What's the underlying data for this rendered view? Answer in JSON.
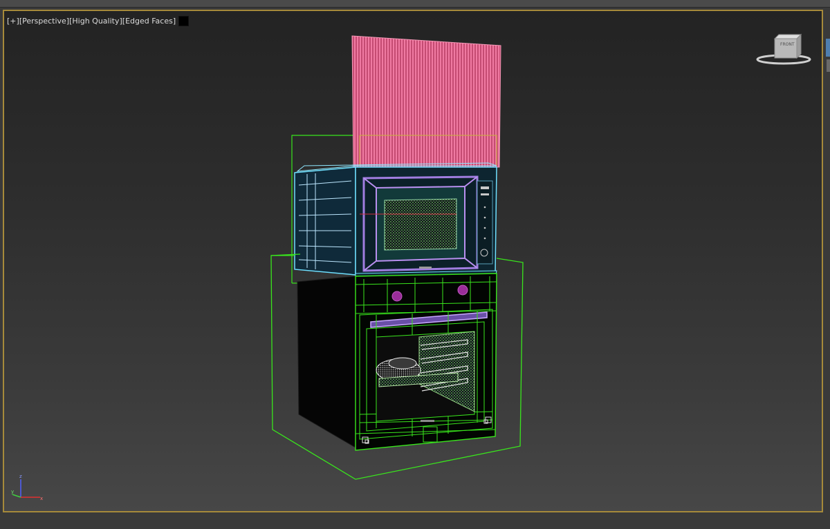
{
  "viewport": {
    "label_plus": "[+]",
    "label_view": "[Perspective]",
    "label_quality": "[High Quality]",
    "label_shading": "[Edged Faces]",
    "border_color": "#a68a3a"
  },
  "viewcube": {
    "face_label": "FRONT"
  },
  "axis": {
    "z_label": "z",
    "y_label": "y",
    "x_label": "x"
  },
  "colors": {
    "selection_green": "#39e61c",
    "microwave_cyan": "#6ee0ff",
    "door_purple": "#a07de0",
    "panel_pink": "#e0608a",
    "knob_magenta": "#9a2d9a"
  }
}
